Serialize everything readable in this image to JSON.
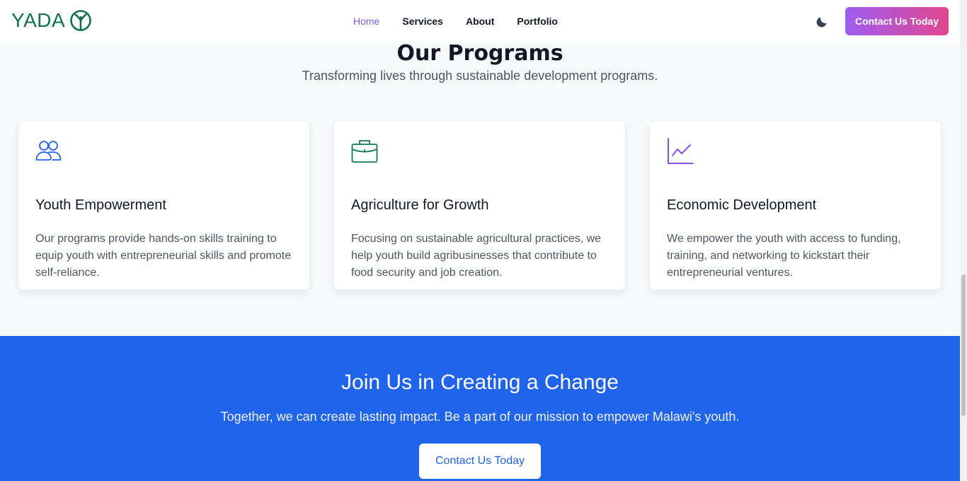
{
  "header": {
    "logo_text": "YADA",
    "nav": [
      {
        "label": "Home",
        "active": true
      },
      {
        "label": "Services",
        "active": false
      },
      {
        "label": "About",
        "active": false
      },
      {
        "label": "Portfolio",
        "active": false
      }
    ],
    "theme_toggle_icon": "moon-icon",
    "cta_label": "Contact Us Today"
  },
  "programs": {
    "title": "Our Programs",
    "subtitle": "Transforming lives through sustainable development programs.",
    "cards": [
      {
        "icon": "users-icon",
        "icon_color": "#2563eb",
        "title": "Youth Empowerment",
        "description": "Our programs provide hands-on skills training to equip youth with entrepreneurial skills and promote self-reliance."
      },
      {
        "icon": "briefcase-icon",
        "icon_color": "#0f7a55",
        "title": "Agriculture for Growth",
        "description": "Focusing on sustainable agricultural practices, we help youth build agribusinesses that contribute to food security and job creation."
      },
      {
        "icon": "chart-line-icon",
        "icon_color": "#7c3aed",
        "title": "Economic Development",
        "description": "We empower the youth with access to funding, training, and networking to kickstart their entrepreneurial ventures."
      }
    ]
  },
  "join": {
    "title": "Join Us in Creating a Change",
    "text": "Together, we can create lasting impact. Be a part of our mission to empower Malawi's youth.",
    "button_label": "Contact Us Today"
  },
  "colors": {
    "accent": "#7c5ce6",
    "brand_green": "#12704f",
    "join_bg": "#1f64ea"
  }
}
